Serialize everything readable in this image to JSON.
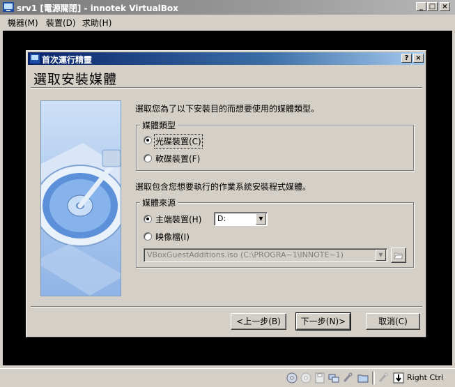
{
  "window": {
    "title": "srv1 [電源關閉] - innotek VirtualBox",
    "controls": [
      "_",
      "□",
      "×"
    ]
  },
  "menubar": {
    "items": [
      "機器(M)",
      "裝置(D)",
      "求助(H)"
    ]
  },
  "wizard": {
    "title": "首次運行精靈",
    "title_buttons": [
      "?",
      "×"
    ],
    "heading": "選取安裝媒體",
    "intro_text": "選取您為了以下安裝目的而想要使用的媒體類型。",
    "media_type": {
      "legend": "媒體類型",
      "options": [
        {
          "label": "光碟裝置(C)",
          "checked": true
        },
        {
          "label": "軟碟裝置(F)",
          "checked": false
        }
      ]
    },
    "source_text": "選取包含您想要執行的作業系統安裝程式媒體。",
    "media_source": {
      "legend": "媒體來源",
      "host_drive_label": "主端裝置(H)",
      "host_drive_checked": true,
      "host_drive_value": "D:",
      "image_file_label": "映像檔(I)",
      "image_file_checked": false,
      "image_file_value": "VBoxGuestAdditions.iso (C:\\PROGRA~1\\INNOTE~1)"
    },
    "buttons": {
      "back": "<上一步(B)",
      "next": "下一步(N)>",
      "cancel": "取消(C)"
    }
  },
  "statusbar": {
    "icons": [
      "cd-icon",
      "floppy-icon",
      "hard-disk-icon",
      "network-icon",
      "usb-icon",
      "shared-folder-icon",
      "mouse-icon",
      "keyboard-capture-icon"
    ],
    "host_key": "Right Ctrl"
  },
  "colors": {
    "dialog_bg": "#d4d0c8",
    "active_title_start": "#0a246a",
    "active_title_end": "#a6caf0",
    "vm_screen": "#000000"
  }
}
